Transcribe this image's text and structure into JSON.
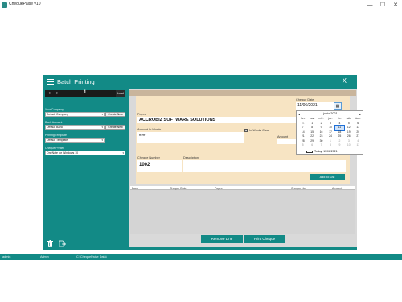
{
  "window": {
    "title": "ChequePaise v10",
    "minimize": "—",
    "maximize": "☐",
    "close": "✕"
  },
  "header": {
    "title": "Batch Printing",
    "close": "X"
  },
  "nav": {
    "first": "<",
    "next": ">",
    "number": "1",
    "load": "Load"
  },
  "sidebar": {
    "company_label": "Your Company",
    "company_value": "Default Company",
    "bank_label": "Bank Account",
    "bank_value": "Default Bank",
    "template_label": "Printing Template",
    "template_value": "Default Template",
    "printer_label": "Cheque Printer",
    "printer_value": "OneNote for Windows 10",
    "create_new": "Create New"
  },
  "form": {
    "payee_label": "Payee",
    "payee_value": "ACCROBIZ SOFTWARE SOLUTIONS",
    "cheque_date_label": "Cheque Date",
    "cheque_date_value": "11/06/2021",
    "amount_words_label": "Amount In Words",
    "amount_words_value": "###",
    "in_words_case_label": "In Words Case",
    "amount_label": "Amount",
    "cheque_number_label": "Cheque Number",
    "cheque_number_value": "1002",
    "description_label": "Description",
    "add_to_list": "Add To List"
  },
  "calendar": {
    "month": "junio 2021",
    "prev": "◂",
    "next": "▸",
    "days": [
      "lun.",
      "mar.",
      "mié.",
      "jue.",
      "vie.",
      "sáb.",
      "dom."
    ],
    "weeks": [
      [
        "31",
        "1",
        "2",
        "3",
        "4",
        "5",
        "6"
      ],
      [
        "7",
        "8",
        "9",
        "10",
        "11",
        "12",
        "13"
      ],
      [
        "14",
        "15",
        "16",
        "17",
        "18",
        "19",
        "20"
      ],
      [
        "21",
        "22",
        "23",
        "24",
        "25",
        "26",
        "27"
      ],
      [
        "28",
        "29",
        "30",
        "1",
        "2",
        "3",
        "4"
      ],
      [
        "5",
        "6",
        "7",
        "8",
        "9",
        "10",
        "11"
      ]
    ],
    "today": "Today: 11/06/2021"
  },
  "table": {
    "columns": [
      "Bank",
      "Cheque Date",
      "Payee",
      "Cheque No.",
      "Amount"
    ]
  },
  "buttons": {
    "remove_line": "Remove Line",
    "print_cheque": "Print Cheque"
  },
  "status": {
    "user": "admin",
    "role": "Admin",
    "path": "C:\\ChequePaise Data\\"
  },
  "colors": {
    "accent": "#128a86",
    "form_bg": "#f7e4c3"
  }
}
